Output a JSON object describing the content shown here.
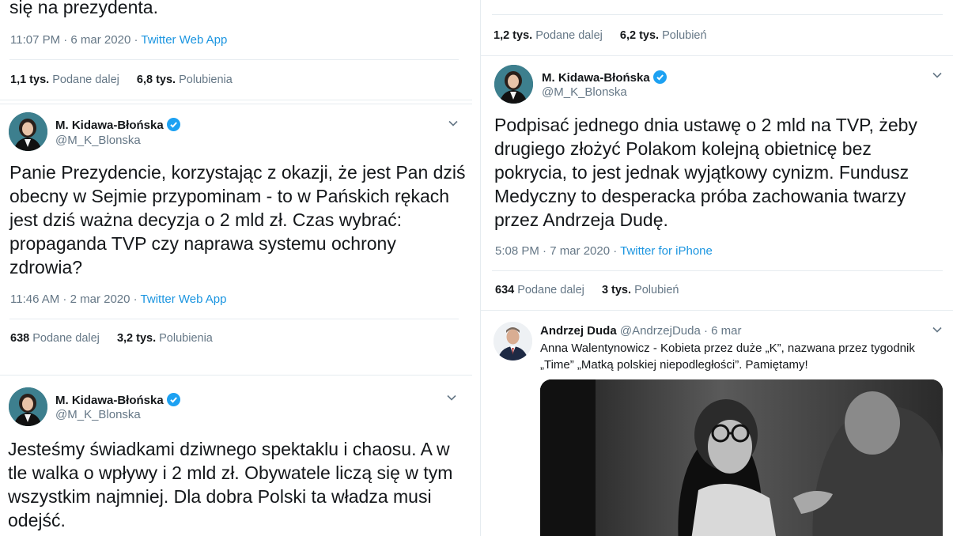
{
  "left": {
    "top_tweet": {
      "text_tail": "się na prezydenta.",
      "time": "11:07 PM · 6 mar 2020",
      "source": "Twitter Web App",
      "retweets_count": "1,1 tys.",
      "retweets_label": "Podane dalej",
      "likes_count": "6,8 tys.",
      "likes_label": "Polubienia"
    },
    "tweet1": {
      "name": "M. Kidawa-Błońska",
      "handle": "@M_K_Blonska",
      "text": "Panie Prezydencie, korzystając z okazji, że jest Pan dziś\nobecny w Sejmie przypominam - to w Pańskich rękach\njest dziś ważna decyzja o 2 mld zł. Czas wybrać:\npropaganda TVP czy naprawa systemu ochrony\nzdrowia?",
      "time": "11:46 AM · 2 mar 2020",
      "source": "Twitter Web App",
      "retweets_count": "638",
      "retweets_label": "Podane dalej",
      "likes_count": "3,2 tys.",
      "likes_label": "Polubienia"
    },
    "tweet2": {
      "name": "M. Kidawa-Błońska",
      "handle": "@M_K_Blonska",
      "text": "Jesteśmy świadkami dziwnego spektaklu i chaosu. A w\ntle walka o wpływy i 2 mld zł. Obywatele liczą się w tym\nwszystkim najmniej. Dla dobra Polski ta władza musi\nodejść."
    }
  },
  "right": {
    "top_tweet": {
      "retweets_count": "1,2 tys.",
      "retweets_label": "Podane dalej",
      "likes_count": "6,2 tys.",
      "likes_label": "Polubień"
    },
    "tweet1": {
      "name": "M. Kidawa-Błońska",
      "handle": "@M_K_Blonska",
      "text": "Podpisać jednego dnia ustawę o 2 mld na TVP, żeby\ndrugiego złożyć Polakom kolejną obietnicę bez\npokrycia, to jest jednak wyjątkowy cynizm. Fundusz\nMedyczny to desperacka próba zachowania twarzy\nprzez Andrzeja Dudę.",
      "time": "5:08 PM · 7 mar 2020",
      "source": "Twitter for iPhone",
      "retweets_count": "634",
      "retweets_label": "Podane dalej",
      "likes_count": "3 tys.",
      "likes_label": "Polubień"
    },
    "tweet2": {
      "name": "Andrzej Duda",
      "handle_date": "@AndrzejDuda · 6 mar",
      "text": "Anna Walentynowicz - Kobieta przez duże „K”, nazwana przez tygodnik\n„Time” „Matką polskiej niepodległości”. Pamiętamy!"
    }
  },
  "colors": {
    "text": "#14171a",
    "secondary": "#657786",
    "link": "#1b95e0",
    "verified": "#1da1f2",
    "divider": "#e6ecf0"
  },
  "icons": [
    "verified-badge-icon",
    "chevron-down-icon",
    "avatar"
  ]
}
